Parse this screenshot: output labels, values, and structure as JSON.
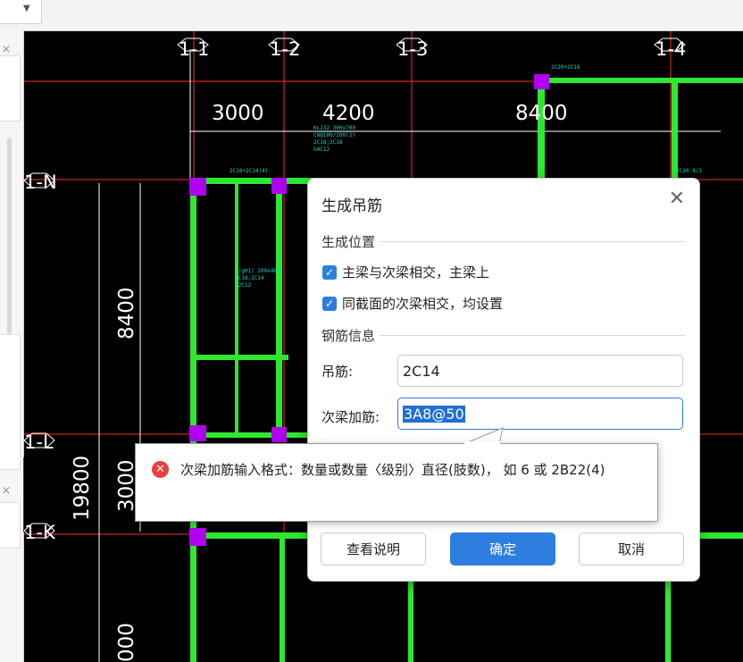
{
  "toolbar": {
    "dropdown_icon": "chevron-down-icon"
  },
  "left_panel": {
    "close_icon": "close-icon",
    "collapse_icon": "chevron-left-icon"
  },
  "drawing": {
    "grid_labels": [
      "1-1",
      "1-2",
      "1-3",
      "1-4",
      "1-N",
      "1-L",
      "1-K"
    ],
    "dimensions": [
      "3000",
      "4200",
      "8400",
      "8400",
      "19800",
      "3000",
      "000"
    ],
    "colors": {
      "beam": "#2ee82e",
      "column": "#b000f0",
      "axis": "#ff2d2d",
      "text": "#ffffff",
      "annotation": "#19d6c8"
    }
  },
  "dialog": {
    "title": "生成吊筋",
    "close_icon": "close-icon",
    "section_position": "生成位置",
    "check_main_secondary": "主梁与次梁相交，主梁上",
    "check_same_section": "同截面的次梁相交，均设置",
    "section_rebar": "钢筋信息",
    "hanger_label": "吊筋:",
    "hanger_value": "2C14",
    "extra_label": "次梁加筋:",
    "extra_value": "3A8@50",
    "btn_help": "查看说明",
    "btn_ok": "确定",
    "btn_cancel": "取消"
  },
  "error_tip": {
    "icon": "error-icon",
    "message": "次梁加筋输入格式：数量或数量〈级别〉直径(肢数)， 如 6 或 2B22(4)"
  }
}
